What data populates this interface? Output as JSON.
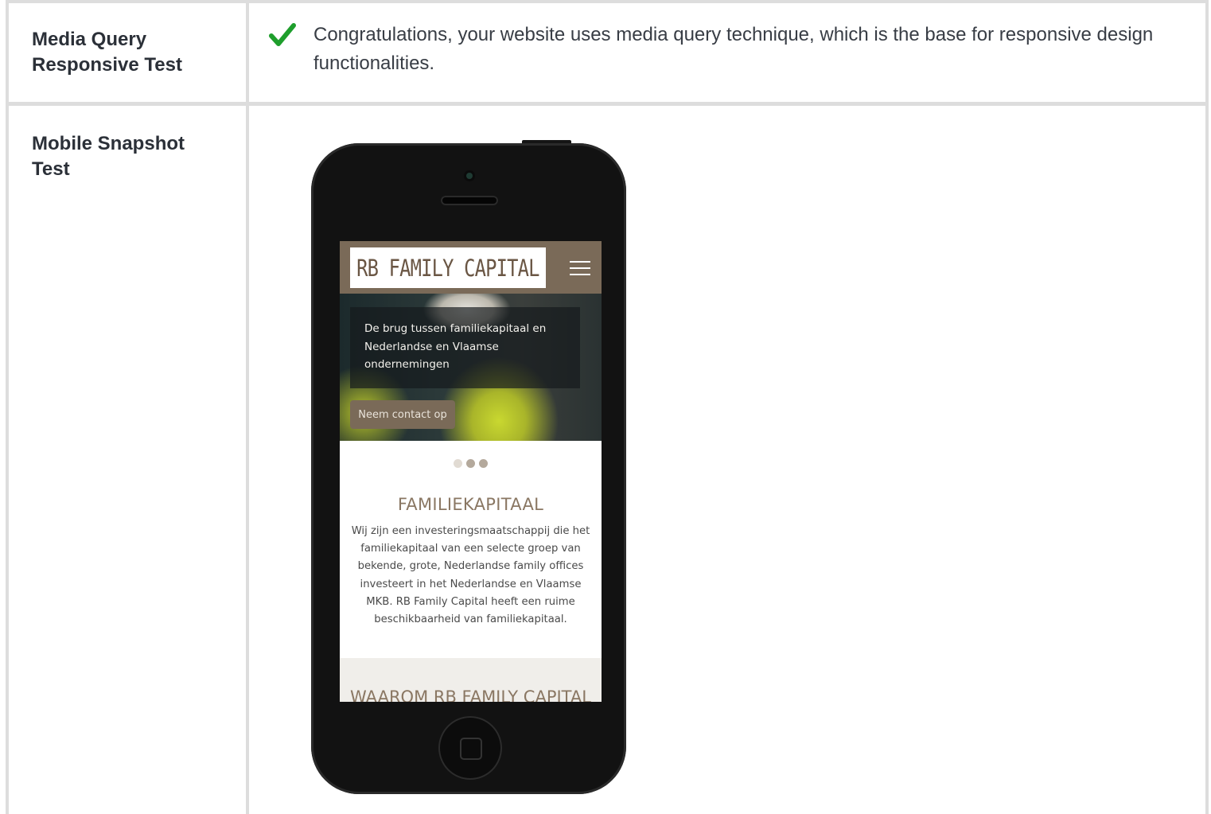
{
  "rows": [
    {
      "label": "Media Query Responsive Test",
      "label_line1": "Media Query",
      "label_line2": "Responsive Test",
      "message": "Congratulations, your website uses media query technique, which is the base for responsive design functionalities.",
      "status_icon": "check-icon",
      "status_color": "#1e9e2c"
    },
    {
      "label": "Mobile Snapshot Test",
      "label_line1": "Mobile Snapshot",
      "label_line2": "Test"
    }
  ],
  "snapshot": {
    "logo_text": "RB FAMILY CAPITAL",
    "menu_icon": "hamburger-menu-icon",
    "hero_text": "De brug tussen familiekapitaal en Nederlandse en Vlaamse ondernemingen",
    "hero_button": "Neem contact op",
    "slider_dots": 3,
    "section_title": "FAMILIEKAPITAAL",
    "section_body": "Wij zijn een investeringsmaatschappij die het familiekapitaal van een selecte groep van bekende, grote, Nederlandse family offices investeert in het Nederlandse en Vlaamse MKB. RB Family Capital heeft een ruime beschikbaarheid van familiekapitaal.",
    "section2_title": "WAAROM RB FAMILY CAPITAL",
    "brand_color": "#7a6a58"
  }
}
